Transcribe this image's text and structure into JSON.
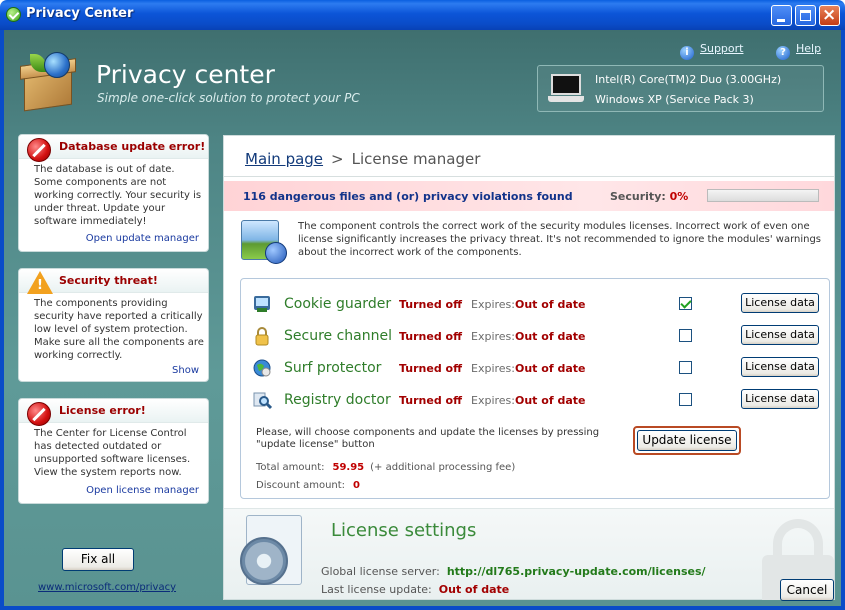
{
  "window": {
    "title": "Privacy Center",
    "colors": {
      "titlebar": "#0a4cc8",
      "accent_green": "#2f7d2a",
      "error_red": "#a20000"
    }
  },
  "header": {
    "heading": "Privacy center",
    "tagline": "Simple one-click solution to protect your PC",
    "support_label": "Support",
    "help_label": "Help",
    "system": {
      "cpu": "Intel(R) Core(TM)2 Duo (3.00GHz)",
      "os": "Windows XP (Service Pack 3)"
    }
  },
  "sidebar": {
    "alerts": [
      {
        "icon": "stop-icon",
        "title": "Database update error!",
        "body": "The database is out of date. Some components are not working correctly. Your security is under threat. Update your software immediately!",
        "link": "Open update manager"
      },
      {
        "icon": "warning-icon",
        "title": "Security threat!",
        "body": "The components providing security have reported a critically low level of system protection. Make sure all the components are working correctly.",
        "link": "Show"
      },
      {
        "icon": "stop-icon",
        "title": "License error!",
        "body": "The Center for License Control has detected outdated or unsupported software licenses. View the system reports now.",
        "link": "Open license manager"
      }
    ],
    "fix_all_label": "Fix all",
    "ms_link": "www.microsoft.com/privacy"
  },
  "main": {
    "breadcrumb": {
      "home": "Main page",
      "separator": ">",
      "current": "License manager"
    },
    "alert_strip": {
      "message": "116 dangerous files and (or) privacy violations found",
      "security_label": "Security:",
      "security_value": "0%",
      "security_fraction": 0
    },
    "intro": "The component controls the correct work of the security modules licenses. Incorrect work of even one license significantly increases the privacy threat. It's not recommended to ignore the modules' warnings about the incorrect work of the components.",
    "components": [
      {
        "icon": "cookie-guarder-icon",
        "name": "Cookie guarder",
        "status": "Turned off",
        "expires_label": "Expires:",
        "expires": "Out of date",
        "checked": true,
        "button": "License data"
      },
      {
        "icon": "padlock-icon",
        "name": "Secure channel",
        "status": "Turned off",
        "expires_label": "Expires:",
        "expires": "Out of date",
        "checked": false,
        "button": "License data"
      },
      {
        "icon": "globe-icon",
        "name": "Surf protector",
        "status": "Turned off",
        "expires_label": "Expires:",
        "expires": "Out of date",
        "checked": false,
        "button": "License data"
      },
      {
        "icon": "magnifier-icon",
        "name": "Registry doctor",
        "status": "Turned off",
        "expires_label": "Expires:",
        "expires": "Out of date",
        "checked": false,
        "button": "License data"
      }
    ],
    "choose_note": "Please, will choose components and update the licenses by  pressing \"update license\" button",
    "update_button": "Update license",
    "total_label": "Total amount:",
    "total_value": "59.95",
    "total_extra": "(+ additional processing fee)",
    "discount_label": "Discount amount:",
    "discount_value": "0",
    "settings": {
      "title": "License settings",
      "server_label": "Global license server:",
      "server_value": "http://dl765.privacy-update.com/licenses/",
      "last_label": "Last license update:",
      "last_value": "Out of date"
    },
    "cancel_label": "Cancel"
  }
}
